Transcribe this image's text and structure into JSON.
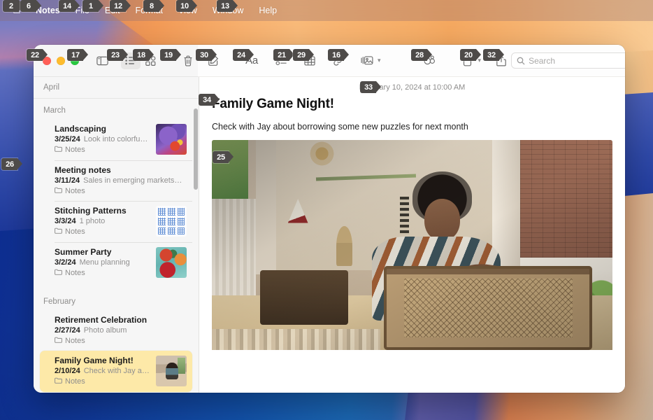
{
  "menubar": {
    "apple_icon": "apple-logo",
    "items": [
      {
        "label": "Notes",
        "badge": "6"
      },
      {
        "label": "File",
        "badge": "14"
      },
      {
        "label": "Edit",
        "badge": "1"
      },
      {
        "label": "Format",
        "badge": "12"
      },
      {
        "label": "View",
        "badge": "8"
      },
      {
        "label": "Window",
        "badge": "10"
      },
      {
        "label": "Help",
        "badge": "13"
      }
    ],
    "apple_badge": "2"
  },
  "window": {
    "traffic_lights_badge": "22",
    "colors": {
      "close": "#ff5f57",
      "minimize": "#febc2e",
      "zoom": "#28c840",
      "selection": "#fde9a8",
      "sidebar_bg": "#f6f6f6"
    }
  },
  "toolbar": {
    "buttons": [
      {
        "name": "sidebar-toggle",
        "badge": "17",
        "icon": "sidebar-icon"
      },
      {
        "name": "list-view",
        "badge": "23",
        "icon": "list-view-icon",
        "active": true
      },
      {
        "name": "gallery-view",
        "badge": "18",
        "icon": "gallery-view-icon"
      },
      {
        "name": "delete-note",
        "badge": "19",
        "icon": "trash-icon"
      },
      {
        "name": "new-note",
        "badge": "30",
        "icon": "compose-icon"
      },
      {
        "name": "format",
        "badge": "24",
        "icon": "format-aa-icon",
        "label": "Aa"
      },
      {
        "name": "checklist",
        "badge": "21",
        "icon": "checklist-icon"
      },
      {
        "name": "table",
        "badge": "29",
        "icon": "table-icon"
      },
      {
        "name": "link",
        "badge": "16",
        "icon": "link-icon"
      },
      {
        "name": "media",
        "badge": "",
        "icon": "media-icon"
      },
      {
        "name": "collaborate",
        "badge": "28",
        "icon": "collaborate-icon"
      },
      {
        "name": "lock",
        "badge": "",
        "icon": "lock-icon"
      },
      {
        "name": "share",
        "badge": "20",
        "icon": "share-icon"
      }
    ]
  },
  "search": {
    "badge": "32",
    "placeholder": "Search",
    "value": "",
    "icon": "search-icon"
  },
  "sidebar": {
    "pinned_month": "April",
    "scrollbar": "vertical-scrollbar",
    "groups": [
      {
        "month": "March",
        "notes": [
          {
            "title": "Landscaping",
            "date": "3/25/24",
            "preview": "Look into colorfu…",
            "folder": "Notes",
            "thumb": "iris-flower",
            "selected": false
          },
          {
            "title": "Meeting notes",
            "date": "3/11/24",
            "preview": "Sales in emerging markets…",
            "folder": "Notes",
            "thumb": "none",
            "selected": false
          },
          {
            "title": "Stitching Patterns",
            "date": "3/3/24",
            "preview": "1 photo",
            "folder": "Notes",
            "thumb": "stitch-grid",
            "selected": false
          },
          {
            "title": "Summer Party",
            "date": "3/2/24",
            "preview": "Menu planning",
            "folder": "Notes",
            "thumb": "food-platter",
            "selected": false
          }
        ]
      },
      {
        "month": "February",
        "notes": [
          {
            "title": "Retirement Celebration",
            "date": "2/27/24",
            "preview": "Photo album",
            "folder": "Notes",
            "thumb": "none",
            "selected": false
          },
          {
            "title": "Family Game Night!",
            "date": "2/10/24",
            "preview": "Check with Jay a…",
            "folder": "Notes",
            "thumb": "game-night-photo",
            "selected": true
          }
        ]
      }
    ]
  },
  "detail": {
    "date": "February 10, 2024 at 10:00 AM",
    "date_badge": "33",
    "title": "Family Game Night!",
    "title_badge": "34",
    "body": "Check with Jay about borrowing some new puzzles for next month",
    "photo_badge": "25",
    "photo_alt": "child-at-table-photo"
  },
  "desktop": {
    "badge": "26"
  }
}
